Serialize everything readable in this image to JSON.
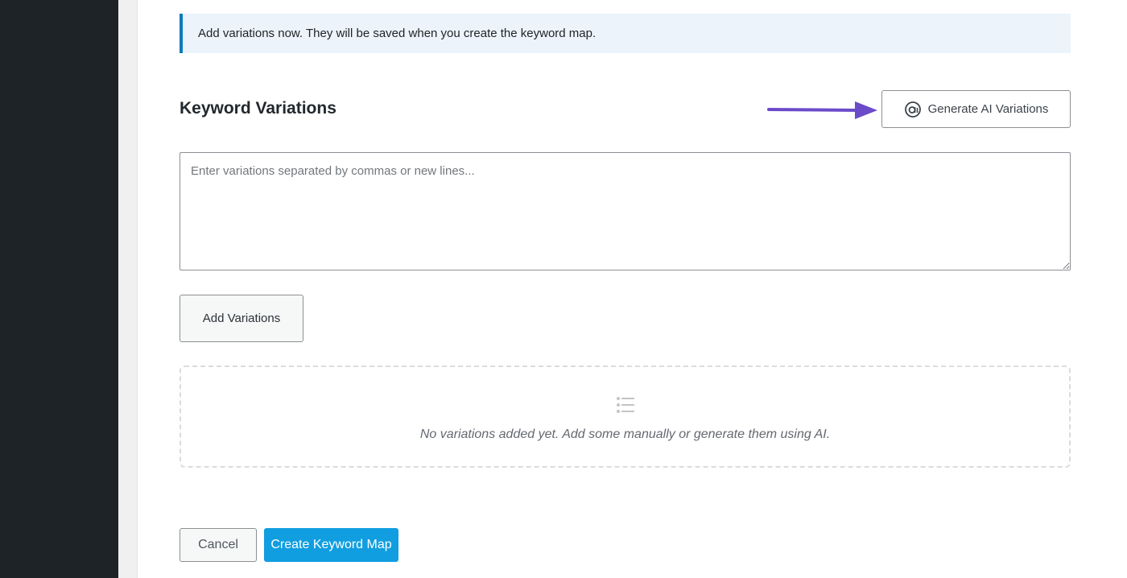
{
  "notice": {
    "text": "Add variations now. They will be saved when you create the keyword map."
  },
  "section": {
    "title": "Keyword Variations"
  },
  "generate_button": {
    "label": "Generate AI Variations",
    "icon": "ai-icon"
  },
  "variations_input": {
    "value": "",
    "placeholder": "Enter variations separated by commas or new lines..."
  },
  "add_button": {
    "label": "Add Variations"
  },
  "empty_state": {
    "icon": "list-icon",
    "message": "No variations added yet. Add some manually or generate them using AI."
  },
  "footer": {
    "cancel_label": "Cancel",
    "create_label": "Create Keyword Map"
  },
  "colors": {
    "accent": "#109ee0",
    "notice_border": "#0a7cba",
    "annotation_arrow": "#6b4bc9",
    "sidebar": "#1d2327"
  }
}
